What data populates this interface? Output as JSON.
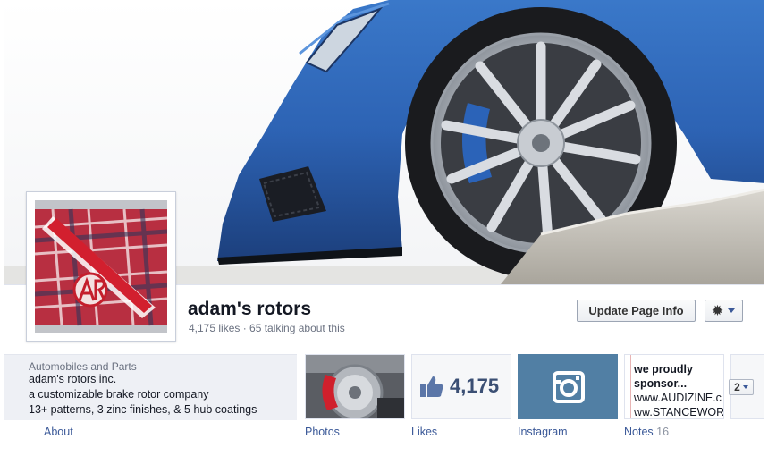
{
  "page": {
    "name": "adam's rotors",
    "stats": "4,175 likes · 65 talking about this"
  },
  "actions": {
    "update_label": "Update Page Info",
    "gear_icon": "gear-icon"
  },
  "about": {
    "category": "Automobiles and Parts",
    "line1": "adam's rotors inc.",
    "line2": "a customizable brake rotor company",
    "line3": "13+ patterns, 3 zinc finishes, & 5 hub coatings",
    "link_label": "About"
  },
  "tabs": [
    {
      "label": "Photos",
      "count": ""
    },
    {
      "label": "Likes",
      "count": "",
      "number": "4,175"
    },
    {
      "label": "Instagram",
      "count": ""
    },
    {
      "label": "Notes",
      "count": "16",
      "preview": [
        "we proudly",
        "sponsor...",
        "www.AUDIZINE.c",
        "ww.STANCEWOR"
      ]
    }
  ],
  "more": {
    "label": "2"
  },
  "colors": {
    "link": "#3b5998",
    "instagram_bg": "#517fa4",
    "car_blue": "#2d63b4"
  }
}
